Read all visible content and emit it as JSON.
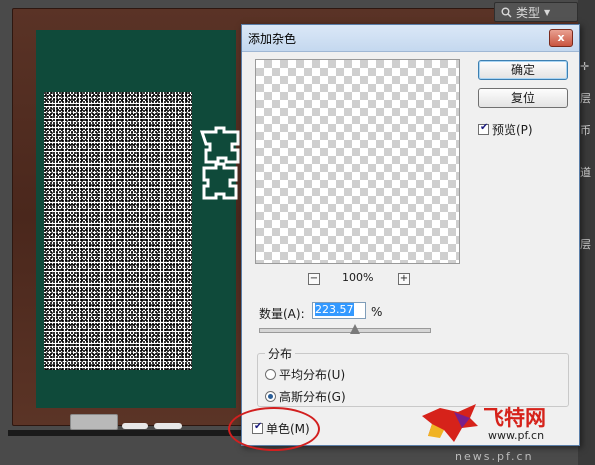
{
  "dialog": {
    "title": "添加杂色",
    "close_glyph": "x",
    "ok_label": "确定",
    "reset_label": "复位",
    "preview_label": "预览(P)",
    "preview_checked": true,
    "zoom_out_glyph": "−",
    "zoom_in_glyph": "+",
    "zoom_level": "100%",
    "amount_label": "数量(A):",
    "amount_value": "223.57",
    "amount_unit": "%",
    "amount_slider_fraction": 0.56,
    "distribution": {
      "title": "分布",
      "options": [
        {
          "label": "平均分布(U)",
          "selected": false
        },
        {
          "label": "高斯分布(G)",
          "selected": true
        }
      ]
    },
    "monochrome_label": "单色(M)",
    "monochrome_checked": true
  },
  "workspace": {
    "search_label": "类型",
    "panel_labels": [
      "层",
      "币",
      "道",
      "层"
    ]
  },
  "watermark": {
    "logo_text": "飞特网",
    "url": "www.pf.cn",
    "url_faded": "news.pf.cn"
  },
  "colors": {
    "highlight": "#d21f1f",
    "board_green": "#0f4a3a",
    "board_frame": "#5a3326"
  }
}
